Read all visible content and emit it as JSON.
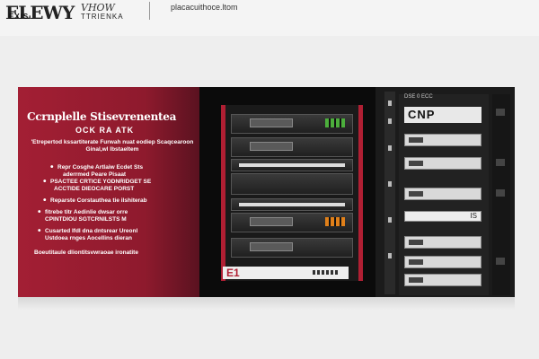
{
  "header": {
    "logo_main": "ELEWY",
    "logo_ex": "VHOW",
    "logo_sub": "EXIS",
    "logo_sub2": "TTRIENKA",
    "url": "placacuithoce.ltom"
  },
  "banner": {
    "title": "Ccrnplelle Stisevrenentea",
    "subtitle": "OCK RA  ATK",
    "intro": "'Etrepertod kssartiterate Furwah nuat eodiep Scaqcearoon Ginal,wl lbstaeltem",
    "bullets": [
      "Repr Cosghe Artlaiw Ecdet Sts",
      "aderrmed Peare Pisaat",
      "PSACTEE CRTICE YODNRIDGET SE",
      "ACCTIDE DIEOCARE PORST",
      "Reparste Corstauthea tie ilshiterab",
      "fitrebe titr Aedinlie dwsar orre",
      "CPINTDIOU SGTCRNILSTS M",
      "Cusarted Ifdl dna dntsrear Ureonl",
      "Ustdoea rnges Aocellins dieran",
      "Boeutitaule dliontitsvwraoae ironatite"
    ],
    "rack_badge": "E1",
    "column_head": "DSE 0 ECC",
    "column_title": "CNP",
    "slot_label": "IS"
  }
}
